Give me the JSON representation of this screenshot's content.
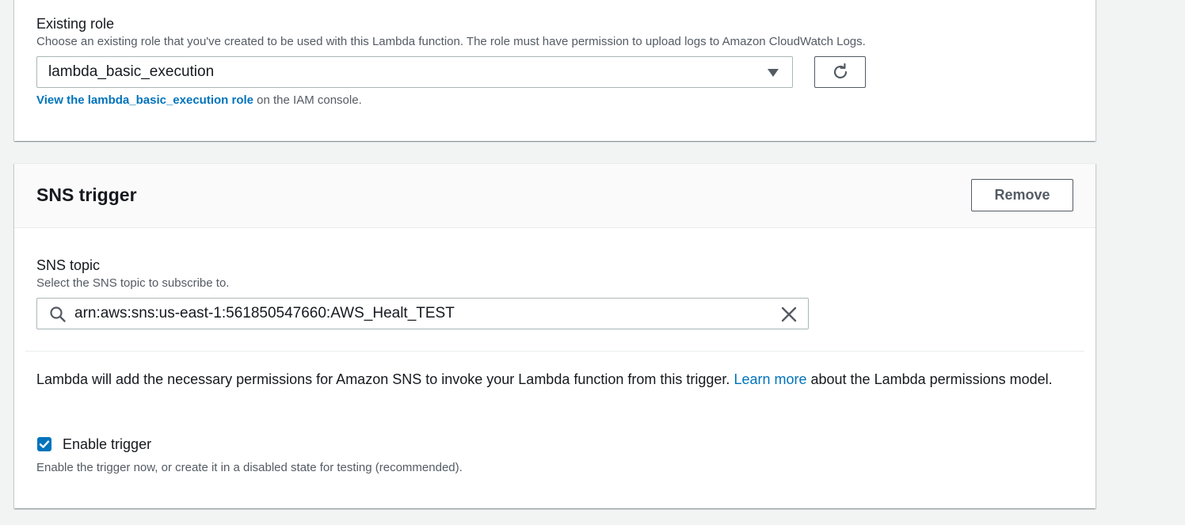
{
  "role_section": {
    "label": "Existing role",
    "description": "Choose an existing role that you've created to be used with this Lambda function. The role must have permission to upload logs to Amazon CloudWatch Logs.",
    "selected_role": "lambda_basic_execution",
    "view_role_link": "View the lambda_basic_execution role",
    "view_role_suffix": " on the IAM console."
  },
  "sns_section": {
    "title": "SNS trigger",
    "remove_label": "Remove",
    "topic_label": "SNS topic",
    "topic_description": "Select the SNS topic to subscribe to.",
    "topic_value": "arn:aws:sns:us-east-1:561850547660:AWS_Healt_TEST",
    "permissions_text_before": "Lambda will add the necessary permissions for Amazon SNS to invoke your Lambda function from this trigger. ",
    "learn_more_link": "Learn more",
    "permissions_text_after": " about the Lambda permissions model.",
    "enable_trigger_label": "Enable trigger",
    "enable_trigger_checked": true,
    "enable_trigger_description": "Enable the trigger now, or create it in a disabled state for testing (recommended)."
  },
  "icons": {
    "dropdown": "caret-down-icon",
    "refresh": "refresh-icon",
    "search": "search-icon",
    "clear": "close-icon",
    "check": "check-icon"
  },
  "colors": {
    "link": "#0073bb",
    "checkbox": "#0073bb",
    "page_background": "#f2f3f3",
    "text_primary": "#16191f",
    "text_secondary": "#545b64"
  }
}
